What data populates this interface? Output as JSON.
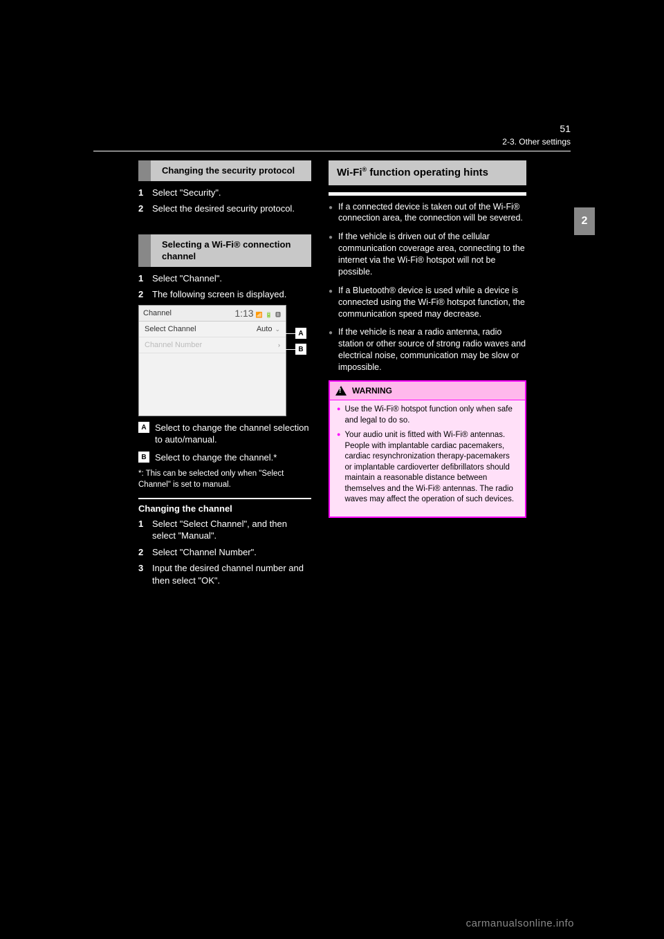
{
  "header": {
    "page_number": "51",
    "chapter_ref": "2-3. Other settings"
  },
  "side_tab": {
    "label": "2"
  },
  "left": {
    "section1": {
      "title": "Changing the security protocol",
      "steps": [
        {
          "num": "1",
          "text": "Select \"Security\"."
        },
        {
          "num": "2",
          "text": "Select the desired security protocol."
        }
      ]
    },
    "section2": {
      "title": "Selecting a Wi-Fi® connection channel",
      "steps": [
        {
          "num": "1",
          "text": "Select \"Channel\"."
        },
        {
          "num": "2",
          "text": "The following screen is displayed."
        }
      ]
    },
    "screenshot": {
      "titlebar_label": "Channel",
      "time": "1:13",
      "row1_left": "Select Channel",
      "row1_right": "Auto",
      "row2_left": "Channel Number",
      "callout_a": "A",
      "callout_b": "B"
    },
    "legend": [
      {
        "badge": "A",
        "text": "Select to change the channel selection to auto/manual."
      },
      {
        "badge": "B",
        "text": "Select to change the channel.*"
      }
    ],
    "footnote": "*: This can be selected only when \"Select Channel\" is set to manual.",
    "subheading": "Changing the channel",
    "sub_steps": [
      {
        "num": "1",
        "text": "Select \"Select Channel\", and then select \"Manual\"."
      },
      {
        "num": "2",
        "text": "Select \"Channel Number\"."
      },
      {
        "num": "3",
        "text": "Input the desired channel number and then select \"OK\"."
      }
    ]
  },
  "right": {
    "heading_prefix": "Wi-Fi",
    "heading_suffix": " function operating hints",
    "bullets": [
      "If a connected device is taken out of the Wi-Fi® connection area, the connection will be severed.",
      "If the vehicle is driven out of the cellular communication coverage area, connecting to the internet via the Wi-Fi® hotspot will not be possible.",
      "If a Bluetooth® device is used while a device is connected using the Wi-Fi® hotspot function, the communication speed may decrease.",
      "If the vehicle is near a radio antenna, radio station or other source of strong radio waves and electrical noise, communication may be slow or impossible."
    ],
    "warning": {
      "title": "WARNING",
      "items": [
        "Use the Wi-Fi® hotspot function only when safe and legal to do so.",
        "Your audio unit is fitted with Wi-Fi® antennas. People with implantable cardiac pacemakers, cardiac resynchronization therapy-pacemakers or implantable cardioverter defibrillators should maintain a reasonable distance between themselves and the Wi-Fi® antennas. The radio waves may affect the operation of such devices."
      ]
    }
  },
  "watermark": "carmanualsonline.info"
}
